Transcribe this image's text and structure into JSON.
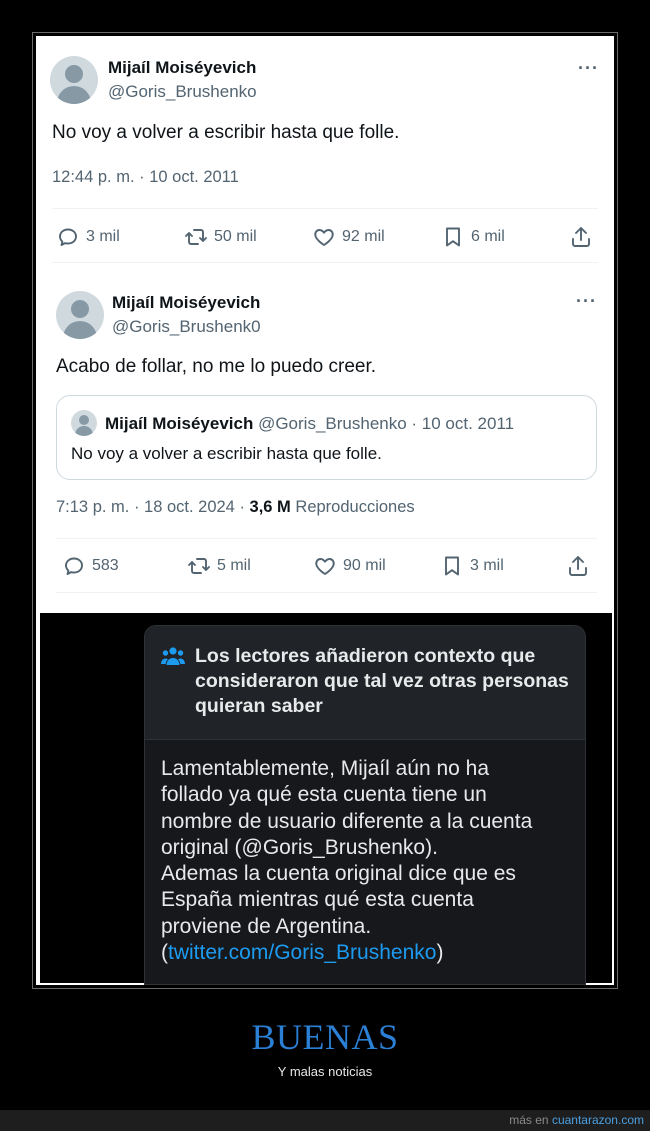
{
  "tweet1": {
    "name": "Mijaíl Moiséyevich",
    "handle": "@Goris_Brushenko",
    "more": "···",
    "text": "No voy a volver a escribir hasta que folle.",
    "time": "12:44 p. m. · 10 oct. 2011",
    "actions": {
      "replies": "3 mil",
      "reposts": "50 mil",
      "likes": "92 mil",
      "bookmarks": "6 mil"
    }
  },
  "tweet2": {
    "name": "Mijaíl Moiséyevich",
    "handle": "@Goris_Brushenk0",
    "more": "···",
    "text": "Acabo de follar, no me lo puedo creer.",
    "quote": {
      "name": "Mijaíl Moiséyevich",
      "meta": "@Goris_Brushenko · 10 oct. 2011",
      "text": "No voy a volver a escribir hasta que folle."
    },
    "time": "7:13 p. m. · 18 oct. 2024 · ",
    "views_count": "3,6 M",
    "views_label": "Reproducciones",
    "actions": {
      "replies": "583",
      "reposts": "5 mil",
      "likes": "90 mil",
      "bookmarks": "3 mil"
    }
  },
  "community_note": {
    "title": "Los lectores añadieron contexto que consideraron que tal vez otras personas quieran saber",
    "lines": [
      "Lamentablemente, Mijaíl aún no ha",
      "follado ya qué esta cuenta tiene un",
      "nombre de usuario diferente a la cuenta",
      "original (@Goris_Brushenko).",
      "Ademas la cuenta original dice que es",
      "España mientras qué esta cuenta",
      "proviene de Argentina."
    ],
    "link_open": "(",
    "link": "twitter.com/Goris_Brushenko",
    "link_close": ")"
  },
  "caption": {
    "title": "BUENAS",
    "subtitle": "Y malas noticias"
  },
  "footer": {
    "prefix": "más en ",
    "site": "cuantarazon.com"
  },
  "colors": {
    "accent": "#1d9bf0",
    "caption_blue": "#2b7fd4",
    "muted": "#536471"
  }
}
